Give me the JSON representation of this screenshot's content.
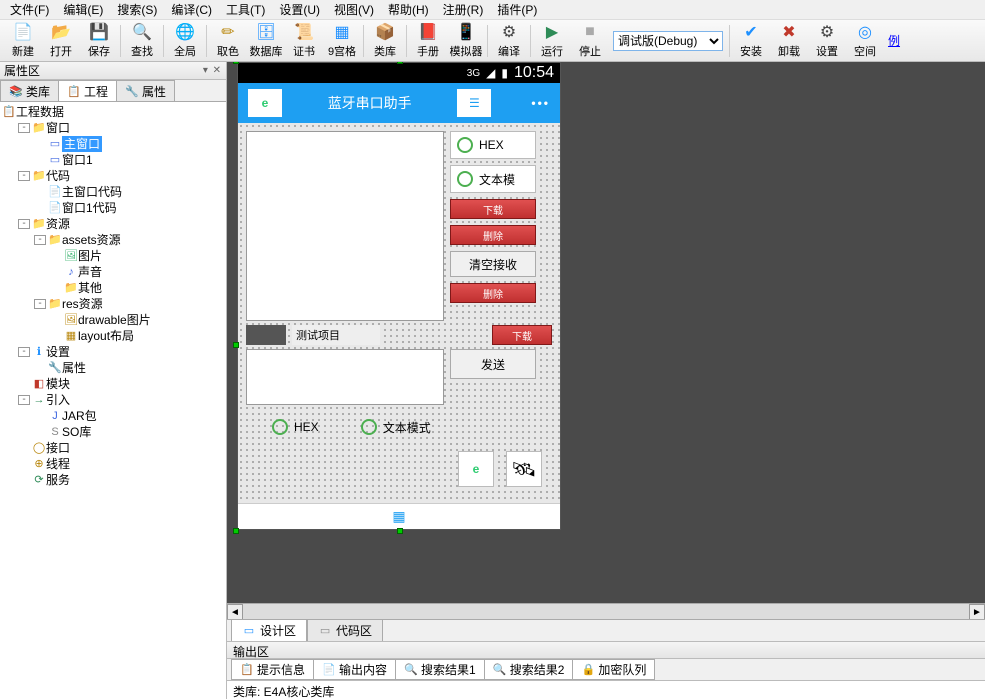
{
  "menu": [
    "文件(F)",
    "编辑(E)",
    "搜索(S)",
    "编译(C)",
    "工具(T)",
    "设置(U)",
    "视图(V)",
    "帮助(H)",
    "注册(R)",
    "插件(P)"
  ],
  "toolbar": {
    "items": [
      {
        "ico": "📄",
        "c": "#e6b800",
        "lbl": "新建"
      },
      {
        "ico": "📂",
        "c": "#e6b800",
        "lbl": "打开"
      },
      {
        "ico": "💾",
        "c": "#4169e1",
        "lbl": "保存"
      },
      {
        "sep": true
      },
      {
        "ico": "🔍",
        "c": "#444",
        "lbl": "查找"
      },
      {
        "sep": true
      },
      {
        "ico": "🌐",
        "c": "#1e90ff",
        "lbl": "全局"
      },
      {
        "sep": true
      },
      {
        "ico": "✏",
        "c": "#b8860b",
        "lbl": "取色"
      },
      {
        "ico": "🗄",
        "c": "#1e90ff",
        "lbl": "数据库"
      },
      {
        "ico": "📜",
        "c": "#b8860b",
        "lbl": "证书"
      },
      {
        "ico": "▦",
        "c": "#1e90ff",
        "lbl": "9宫格"
      },
      {
        "sep": true
      },
      {
        "ico": "📦",
        "c": "#b8860b",
        "lbl": "类库"
      },
      {
        "sep": true
      },
      {
        "ico": "📕",
        "c": "#c0392b",
        "lbl": "手册"
      },
      {
        "ico": "📱",
        "c": "#444",
        "lbl": "模拟器"
      },
      {
        "sep": true
      },
      {
        "ico": "⚙",
        "c": "#444",
        "lbl": "编译"
      },
      {
        "sep": true
      },
      {
        "ico": "▶",
        "c": "#2e8b57",
        "lbl": "运行"
      },
      {
        "ico": "■",
        "c": "#aaa",
        "lbl": "停止"
      }
    ],
    "combo": "调试版(Debug)",
    "right": [
      {
        "ico": "✔",
        "c": "#1e90ff",
        "lbl": "安装"
      },
      {
        "ico": "✖",
        "c": "#c0392b",
        "lbl": "卸载"
      },
      {
        "ico": "⚙",
        "c": "#444",
        "lbl": "设置"
      },
      {
        "ico": "◎",
        "c": "#1e90ff",
        "lbl": "空间"
      }
    ],
    "link": "例"
  },
  "sidebar": {
    "title": "属性区",
    "ctrl": "▾ ✕",
    "tabs": [
      {
        "ico": "📚",
        "lbl": "类库"
      },
      {
        "ico": "📋",
        "lbl": "工程"
      },
      {
        "ico": "🔧",
        "lbl": "属性"
      }
    ]
  },
  "tree": {
    "root": "工程数据",
    "n": [
      {
        "d": 1,
        "e": "-",
        "i": "folder",
        "t": "窗口"
      },
      {
        "d": 2,
        "e": "",
        "i": "win",
        "t": "主窗口",
        "sel": true
      },
      {
        "d": 2,
        "e": "",
        "i": "win",
        "t": "窗口1"
      },
      {
        "d": 1,
        "e": "-",
        "i": "folder",
        "t": "代码"
      },
      {
        "d": 2,
        "e": "",
        "i": "code",
        "t": "主窗口代码"
      },
      {
        "d": 2,
        "e": "",
        "i": "code",
        "t": "窗口1代码"
      },
      {
        "d": 1,
        "e": "-",
        "i": "folder",
        "t": "资源"
      },
      {
        "d": 2,
        "e": "-",
        "i": "folder",
        "t": "assets资源"
      },
      {
        "d": 3,
        "e": "",
        "i": "img",
        "t": "图片"
      },
      {
        "d": 3,
        "e": "",
        "i": "snd",
        "t": "声音"
      },
      {
        "d": 3,
        "e": "",
        "i": "folder",
        "t": "其他"
      },
      {
        "d": 2,
        "e": "-",
        "i": "folder",
        "t": "res资源"
      },
      {
        "d": 3,
        "e": "",
        "i": "img2",
        "t": "drawable图片"
      },
      {
        "d": 3,
        "e": "",
        "i": "lay",
        "t": "layout布局"
      },
      {
        "d": 1,
        "e": "-",
        "i": "info",
        "t": "设置"
      },
      {
        "d": 2,
        "e": "",
        "i": "prop",
        "t": "属性"
      },
      {
        "d": 1,
        "e": "",
        "i": "mod",
        "t": "模块"
      },
      {
        "d": 1,
        "e": "-",
        "i": "imp",
        "t": "引入"
      },
      {
        "d": 2,
        "e": "",
        "i": "jar",
        "t": "JAR包"
      },
      {
        "d": 2,
        "e": "",
        "i": "so",
        "t": "SO库"
      },
      {
        "d": 1,
        "e": "",
        "i": "intf",
        "t": "接口"
      },
      {
        "d": 1,
        "e": "",
        "i": "thr",
        "t": "线程"
      },
      {
        "d": 1,
        "e": "",
        "i": "srv",
        "t": "服务"
      }
    ]
  },
  "phone": {
    "time": "10:54",
    "title": "蓝牙串口助手",
    "sig": "3G",
    "hex": "HEX",
    "textmode": "文本模式",
    "textmode_s": "文本模",
    "down": "下载",
    "del": "删除",
    "clear": "清空接收",
    "send": "发送",
    "testitem": "测试项目"
  },
  "btabs": [
    {
      "lbl": "设计区",
      "a": true
    },
    {
      "lbl": "代码区",
      "a": false
    }
  ],
  "output": {
    "title": "输出区",
    "tabs": [
      "提示信息",
      "输出内容",
      "搜索结果1",
      "搜索结果2",
      "加密队列"
    ],
    "text": "类库: E4A核心类库"
  }
}
